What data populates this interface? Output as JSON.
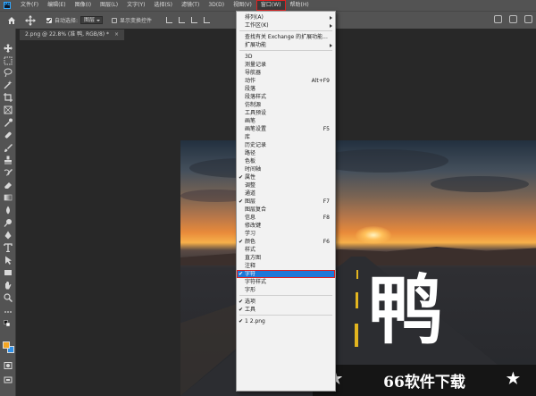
{
  "menubar": {
    "logo": "Ps",
    "items": [
      "文件(F)",
      "编辑(E)",
      "图像(I)",
      "图层(L)",
      "文字(Y)",
      "选择(S)",
      "滤镜(T)",
      "3D(D)",
      "视图(V)",
      "窗口(W)",
      "帮助(H)"
    ],
    "active": "窗口(W)"
  },
  "optionsbar": {
    "auto_select_label": "自动选择:",
    "auto_select_value": "图层",
    "show_transform_label": "显示变换控件"
  },
  "document_tab": {
    "title": "2.png @ 22.8% (准 鸭, RGB/8) *",
    "close": "×"
  },
  "canvas": {
    "big_char": "鸭"
  },
  "watermark": {
    "text": "66软件下载",
    "star": "★"
  },
  "window_menu": {
    "items": [
      {
        "label": "排列(A)",
        "submenu": true
      },
      {
        "label": "工作区(K)",
        "submenu": true
      },
      {
        "label": "查找有关 Exchange 的扩展功能...",
        "separator_before": true
      },
      {
        "label": "扩展功能",
        "submenu": true
      },
      {
        "label": "3D",
        "separator_before": true
      },
      {
        "label": "测量记录"
      },
      {
        "label": "导航器"
      },
      {
        "label": "动作",
        "shortcut": "Alt+F9"
      },
      {
        "label": "段落"
      },
      {
        "label": "段落样式"
      },
      {
        "label": "仿制源"
      },
      {
        "label": "工具预设"
      },
      {
        "label": "画笔"
      },
      {
        "label": "画笔设置",
        "shortcut": "F5"
      },
      {
        "label": "库"
      },
      {
        "label": "历史记录"
      },
      {
        "label": "路径"
      },
      {
        "label": "色板"
      },
      {
        "label": "时间轴"
      },
      {
        "label": "属性",
        "checked": true
      },
      {
        "label": "调整"
      },
      {
        "label": "通道"
      },
      {
        "label": "图层",
        "checked": true,
        "shortcut": "F7"
      },
      {
        "label": "图层复合"
      },
      {
        "label": "信息",
        "shortcut": "F8"
      },
      {
        "label": "修改键"
      },
      {
        "label": "学习"
      },
      {
        "label": "颜色",
        "checked": true,
        "shortcut": "F6"
      },
      {
        "label": "样式"
      },
      {
        "label": "直方图"
      },
      {
        "label": "注释"
      },
      {
        "label": "字符",
        "checked": true,
        "highlighted": true
      },
      {
        "label": "字符样式"
      },
      {
        "label": "字形"
      },
      {
        "label": "选项",
        "checked": true,
        "separator_before": true
      },
      {
        "label": "工具",
        "checked": true
      },
      {
        "label": "1 2.png",
        "checked": true,
        "separator_before": true
      }
    ]
  },
  "colors": {
    "foreground": "#f5a623",
    "background": "#2f8fe6",
    "highlight": "#1e78d8"
  }
}
